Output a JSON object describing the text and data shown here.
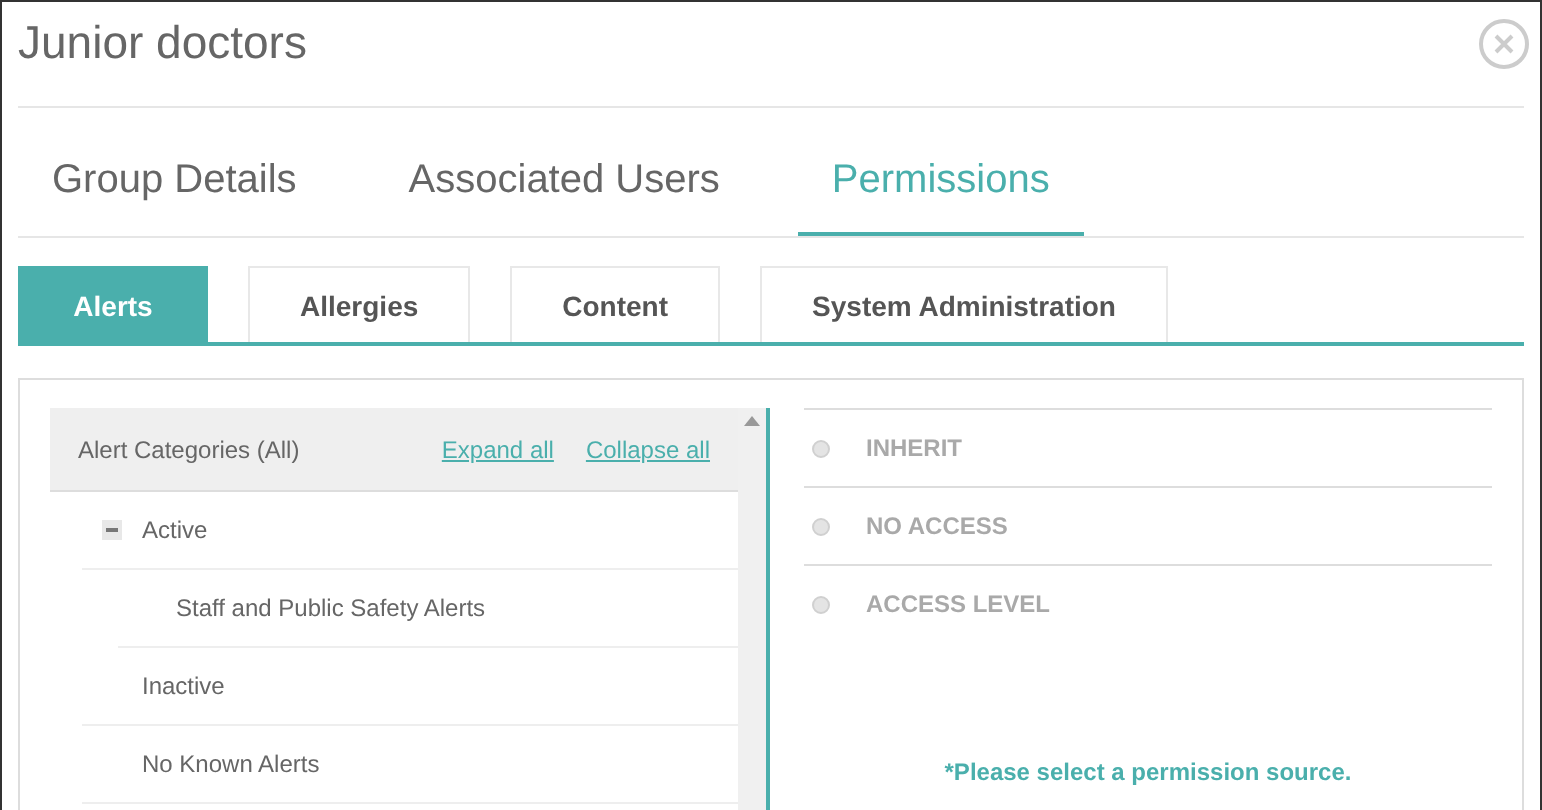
{
  "window": {
    "title": "Junior doctors"
  },
  "tabs": [
    {
      "label": "Group Details",
      "selected": false
    },
    {
      "label": "Associated Users",
      "selected": false
    },
    {
      "label": "Permissions",
      "selected": true
    }
  ],
  "subtabs": [
    {
      "label": "Alerts",
      "selected": true
    },
    {
      "label": "Allergies",
      "selected": false
    },
    {
      "label": "Content",
      "selected": false
    },
    {
      "label": "System Administration",
      "selected": false
    }
  ],
  "tree": {
    "header": "Alert Categories (All)",
    "expand_all": "Expand all",
    "collapse_all": "Collapse all",
    "items": [
      {
        "label": "Active",
        "expanded": true,
        "children": [
          {
            "label": "Staff and Public Safety Alerts"
          }
        ]
      },
      {
        "label": "Inactive"
      },
      {
        "label": "No Known Alerts"
      }
    ]
  },
  "permissions": {
    "options": [
      {
        "label": "INHERIT",
        "selected": false,
        "disabled": true
      },
      {
        "label": "NO ACCESS",
        "selected": false,
        "disabled": true
      },
      {
        "label": "ACCESS LEVEL",
        "selected": false,
        "disabled": true
      }
    ],
    "note": "*Please select a permission source."
  }
}
